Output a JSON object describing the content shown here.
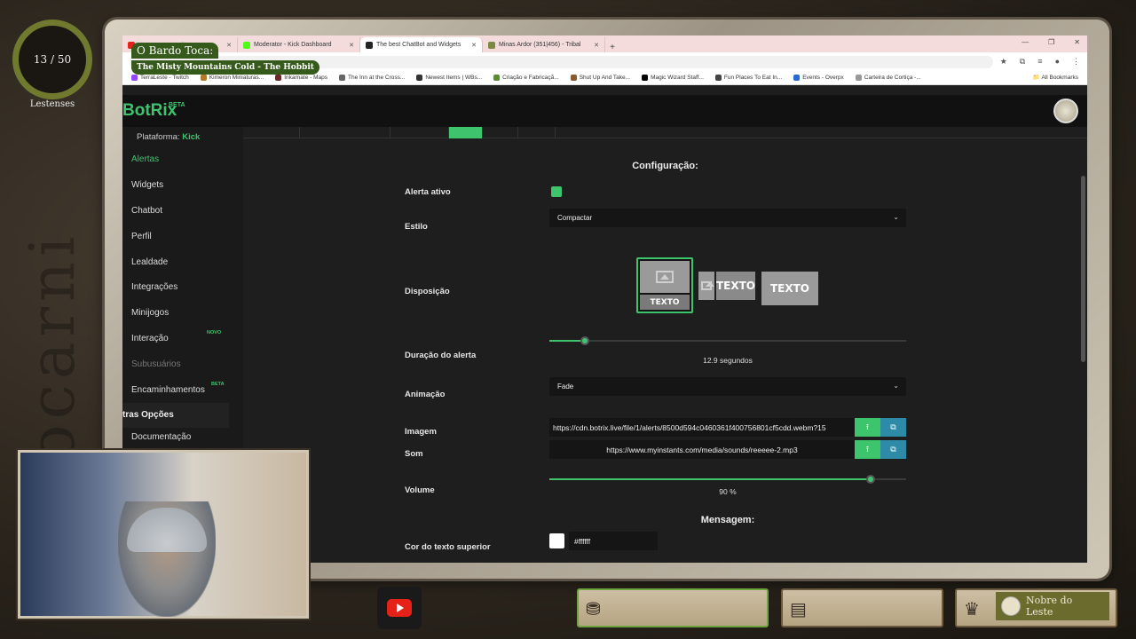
{
  "stream": {
    "counter": "13 / 50",
    "counter_label": "Lestenses",
    "now_playing_title": "O Bardo Toca:",
    "now_playing_song": "The Misty Mountains Cold - The Hobbit",
    "badge_label": "Nobre do Leste"
  },
  "browser": {
    "tabs": [
      {
        "label": "",
        "color": "#e62117"
      },
      {
        "label": "Moderator - Kick Dashboard",
        "color": "#53fc18"
      },
      {
        "label": "The best ChatBot and Widgets",
        "color": "#222222"
      },
      {
        "label": "Minas Ardor (351|456) - Tribal",
        "color": "#7a8a40"
      }
    ],
    "bookmarks": [
      {
        "label": "TerraLeste - Twitch",
        "color": "#9146ff"
      },
      {
        "label": "Kimeron Miniaturas...",
        "color": "#b07a2a"
      },
      {
        "label": "Inkarnate - Maps",
        "color": "#6a2a2a"
      },
      {
        "label": "The Inn at the Cross...",
        "color": "#666666"
      },
      {
        "label": "Newest Items | WBs...",
        "color": "#333333"
      },
      {
        "label": "Criação e Fabricaçã...",
        "color": "#5a8a3a"
      },
      {
        "label": "Shut Up And Take...",
        "color": "#8a5a2a"
      },
      {
        "label": "Magic Wizard Staff...",
        "color": "#000000"
      },
      {
        "label": "Fun Places To Eat In...",
        "color": "#444444"
      },
      {
        "label": "Events - Overpx",
        "color": "#2a6aca"
      },
      {
        "label": "Carteira de Cortiça -...",
        "color": "#999999"
      }
    ],
    "all_bookmarks": "All Bookmarks"
  },
  "app": {
    "logo": "BotRix",
    "logo_badge": "BETA",
    "platform_label": "Plataforma:",
    "platform_value": "Kick",
    "nav": [
      {
        "label": "Alertas",
        "state": "active",
        "badge": ""
      },
      {
        "label": "Widgets",
        "state": "",
        "badge": ""
      },
      {
        "label": "Chatbot",
        "state": "",
        "badge": ""
      },
      {
        "label": "Perfil",
        "state": "",
        "badge": ""
      },
      {
        "label": "Lealdade",
        "state": "",
        "badge": ""
      },
      {
        "label": "Integrações",
        "state": "",
        "badge": ""
      },
      {
        "label": "Minijogos",
        "state": "",
        "badge": ""
      },
      {
        "label": "Interação",
        "state": "",
        "badge": "NOVO"
      },
      {
        "label": "Subusuários",
        "state": "dim",
        "badge": ""
      },
      {
        "label": "Encaminhamentos",
        "state": "",
        "badge": "BETA"
      }
    ],
    "section_other": "tras Opções",
    "doc_label": "Documentação"
  },
  "config": {
    "title": "Configuração:",
    "alert_active_label": "Alerta ativo",
    "alert_active": true,
    "style_label": "Estilo",
    "style_value": "Compactar",
    "layout_label": "Disposição",
    "layout_text": "TEXTO",
    "duration_label": "Duração do alerta",
    "duration_fraction": 0.1,
    "duration_value": "12.9",
    "duration_unit": "segundos",
    "animation_label": "Animação",
    "animation_value": "Fade",
    "image_label": "Imagem",
    "image_url": "https://cdn.botrix.live/file/1/alerts/8500d594c0460361f400756801cf5cdd.webm?15",
    "sound_label": "Som",
    "sound_url": "https://www.myinstants.com/media/sounds/reeeee-2.mp3",
    "volume_label": "Volume",
    "volume_fraction": 0.9,
    "volume_value": "90",
    "volume_unit": "%",
    "message_title": "Mensagem:",
    "top_text_color_label": "Cor do texto superior",
    "top_text_color": "#ffffff",
    "accent_color": "#3ec46d"
  }
}
